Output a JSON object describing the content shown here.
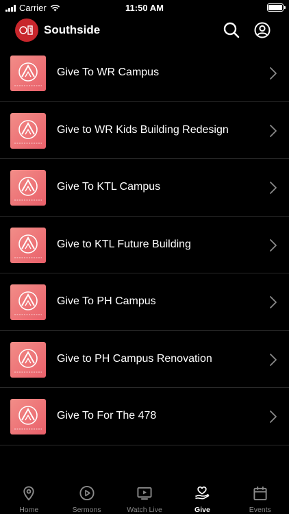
{
  "status_bar": {
    "carrier": "Carrier",
    "time": "11:50 AM"
  },
  "header": {
    "title": "Southside"
  },
  "gives": [
    {
      "label": "Give To WR Campus"
    },
    {
      "label": "Give to WR Kids Building Redesign"
    },
    {
      "label": "Give To KTL Campus"
    },
    {
      "label": "Give to KTL Future Building"
    },
    {
      "label": "Give To PH Campus"
    },
    {
      "label": "Give to PH Campus Renovation"
    },
    {
      "label": "Give To For The 478"
    }
  ],
  "tabs": [
    {
      "label": "Home",
      "icon": "location-pin-icon"
    },
    {
      "label": "Sermons",
      "icon": "play-circle-icon"
    },
    {
      "label": "Watch Live",
      "icon": "tv-play-icon"
    },
    {
      "label": "Give",
      "icon": "heart-hand-icon",
      "active": true
    },
    {
      "label": "Events",
      "icon": "calendar-icon"
    }
  ],
  "colors": {
    "background": "#000000",
    "logo_red": "#c8262c",
    "thumb_pink": "#f28d88",
    "inactive_tab": "#8a8a8a"
  }
}
